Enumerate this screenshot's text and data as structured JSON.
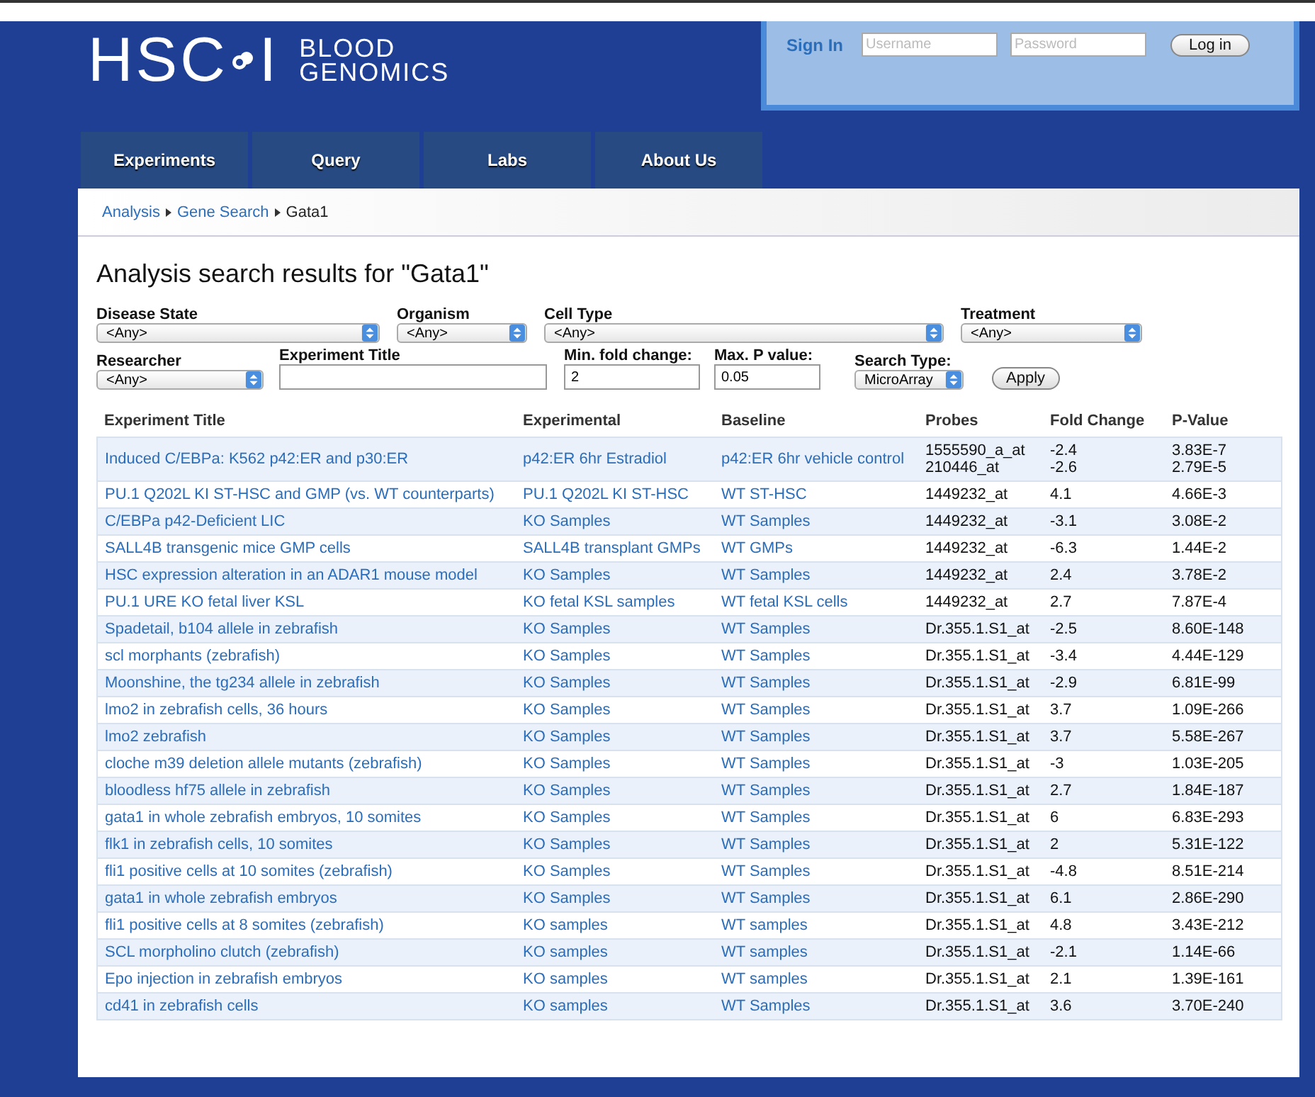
{
  "logo": {
    "left": "HSC",
    "right": "I",
    "tagline": "BLOOD\nGENOMICS"
  },
  "sign_in": {
    "label": "Sign In",
    "username": {
      "placeholder": "Username"
    },
    "password": {
      "placeholder": "Password"
    },
    "button": "Log in"
  },
  "nav": [
    {
      "label": "Experiments"
    },
    {
      "label": "Query"
    },
    {
      "label": "Labs"
    },
    {
      "label": "About Us"
    }
  ],
  "breadcrumb": [
    {
      "label": "Analysis",
      "link": true
    },
    {
      "label": "Gene Search",
      "link": true
    },
    {
      "label": "Gata1",
      "link": false
    }
  ],
  "title": "Analysis search results for \"Gata1\"",
  "filters": [
    [
      {
        "kind": "select",
        "label": "Disease State",
        "value": "<Any>"
      },
      {
        "kind": "select",
        "label": "Organism",
        "value": "<Any>"
      },
      {
        "kind": "select",
        "label": "Cell Type",
        "value": "<Any>"
      },
      {
        "kind": "select",
        "label": "Treatment",
        "value": "<Any>"
      }
    ],
    [
      {
        "kind": "select",
        "label": "Researcher",
        "value": "<Any>"
      },
      {
        "kind": "text",
        "label": "Experiment Title"
      },
      {
        "kind": "text",
        "label": "Min. fold change:",
        "value": "2"
      },
      {
        "kind": "text",
        "label": "Max. P value:",
        "value": "0.05"
      },
      {
        "kind": "select",
        "label": "Search Type:",
        "value": "MicroArray"
      },
      {
        "kind": "button",
        "label": "Apply"
      }
    ]
  ],
  "table": {
    "columns": [
      "Experiment Title",
      "Experimental",
      "Baseline",
      "Probes",
      "Fold Change",
      "P-Value"
    ],
    "rows": [
      [
        "Induced C/EBPa: K562 p42:ER and p30:ER",
        "p42:ER 6hr Estradiol",
        "p42:ER 6hr vehicle control",
        "1555590_a_at\n210446_at",
        "-2.4\n-2.6",
        "3.83E-7\n2.79E-5"
      ],
      [
        "PU.1 Q202L KI ST-HSC and GMP (vs. WT counterparts)",
        "PU.1 Q202L KI ST-HSC",
        "WT ST-HSC",
        "1449232_at",
        "4.1",
        "4.66E-3"
      ],
      [
        "C/EBPa p42-Deficient LIC",
        "KO Samples",
        "WT Samples",
        "1449232_at",
        "-3.1",
        "3.08E-2"
      ],
      [
        "SALL4B transgenic mice GMP cells",
        "SALL4B transplant GMPs",
        "WT GMPs",
        "1449232_at",
        "-6.3",
        "1.44E-2"
      ],
      [
        "HSC expression alteration in an ADAR1 mouse model",
        "KO Samples",
        "WT Samples",
        "1449232_at",
        "2.4",
        "3.78E-2"
      ],
      [
        "PU.1 URE KO fetal liver KSL",
        "KO fetal KSL samples",
        "WT fetal KSL cells",
        "1449232_at",
        "2.7",
        "7.87E-4"
      ],
      [
        "Spadetail, b104 allele in zebrafish",
        "KO Samples",
        "WT Samples",
        "Dr.355.1.S1_at",
        "-2.5",
        "8.60E-148"
      ],
      [
        "scl morphants (zebrafish)",
        "KO Samples",
        "WT Samples",
        "Dr.355.1.S1_at",
        "-3.4",
        "4.44E-129"
      ],
      [
        "Moonshine, the tg234 allele in zebrafish",
        "KO Samples",
        "WT Samples",
        "Dr.355.1.S1_at",
        "-2.9",
        "6.81E-99"
      ],
      [
        "lmo2 in zebrafish cells, 36 hours",
        "KO Samples",
        "WT Samples",
        "Dr.355.1.S1_at",
        "3.7",
        "1.09E-266"
      ],
      [
        "lmo2 zebrafish",
        "KO Samples",
        "WT Samples",
        "Dr.355.1.S1_at",
        "3.7",
        "5.58E-267"
      ],
      [
        "cloche m39 deletion allele mutants (zebrafish)",
        "KO Samples",
        "WT Samples",
        "Dr.355.1.S1_at",
        "-3",
        "1.03E-205"
      ],
      [
        "bloodless hf75 allele in zebrafish",
        "KO Samples",
        "WT Samples",
        "Dr.355.1.S1_at",
        "2.7",
        "1.84E-187"
      ],
      [
        "gata1 in whole zebrafish embryos, 10 somites",
        "KO Samples",
        "WT Samples",
        "Dr.355.1.S1_at",
        "6",
        "6.83E-293"
      ],
      [
        "flk1 in zebrafish cells, 10 somites",
        "KO Samples",
        "WT Samples",
        "Dr.355.1.S1_at",
        "2",
        "5.31E-122"
      ],
      [
        "fli1 positive cells at 10 somites (zebrafish)",
        "KO Samples",
        "WT Samples",
        "Dr.355.1.S1_at",
        "-4.8",
        "8.51E-214"
      ],
      [
        "gata1 in whole zebrafish embryos",
        "KO Samples",
        "WT Samples",
        "Dr.355.1.S1_at",
        "6.1",
        "2.86E-290"
      ],
      [
        "fli1 positive cells at 8 somites (zebrafish)",
        "KO samples",
        "WT samples",
        "Dr.355.1.S1_at",
        "4.8",
        "3.43E-212"
      ],
      [
        "SCL morpholino clutch (zebrafish)",
        "KO samples",
        "WT samples",
        "Dr.355.1.S1_at",
        "-2.1",
        "1.14E-66"
      ],
      [
        "Epo injection in zebrafish embryos",
        "KO samples",
        "WT samples",
        "Dr.355.1.S1_at",
        "2.1",
        "1.39E-161"
      ],
      [
        "cd41 in zebrafish cells",
        "KO samples",
        "WT Samples",
        "Dr.355.1.S1_at",
        "3.6",
        "3.70E-240"
      ]
    ]
  }
}
